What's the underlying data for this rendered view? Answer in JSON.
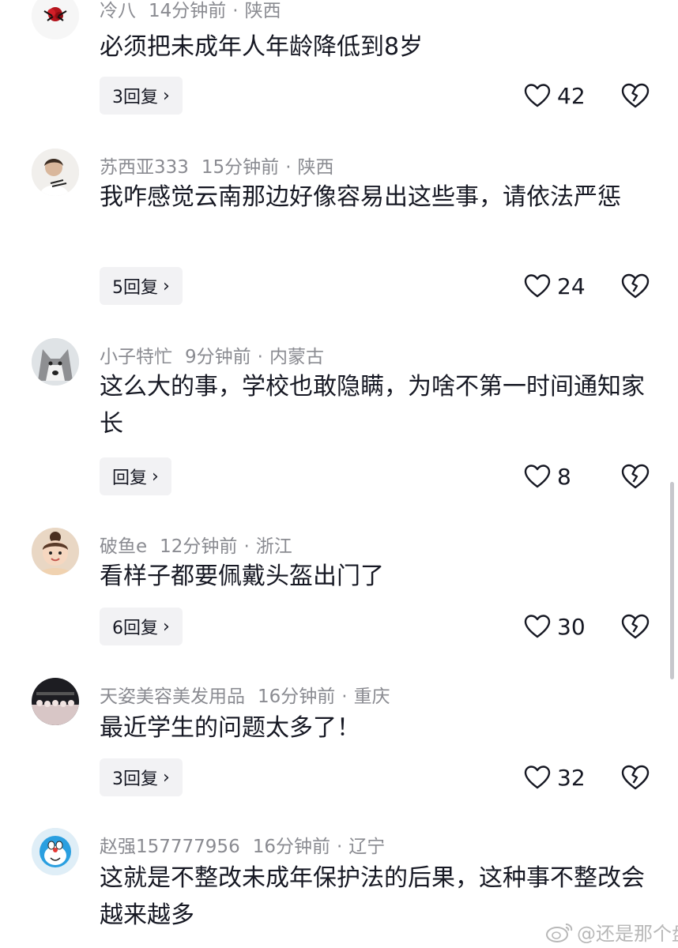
{
  "comments": [
    {
      "user": "冷八",
      "time": "14分钟前",
      "location": "陕西",
      "text": "必须把未成年人年龄降低到8岁",
      "replies": "3回复",
      "likes": "42"
    },
    {
      "user": "苏西亚333",
      "time": "15分钟前",
      "location": "陕西",
      "text": "我咋感觉云南那边好像容易出这些事，请依法严惩",
      "replies": "5回复",
      "likes": "24"
    },
    {
      "user": "小子特忙",
      "time": "9分钟前",
      "location": "内蒙古",
      "text": "这么大的事，学校也敢隐瞒，为啥不第一时间通知家长",
      "replies": "回复",
      "likes": "8"
    },
    {
      "user": "破鱼e",
      "time": "12分钟前",
      "location": "浙江",
      "text": "看样子都要佩戴头盔出门了",
      "replies": "6回复",
      "likes": "30"
    },
    {
      "user": "天姿美容美发用品",
      "time": "16分钟前",
      "location": "重庆",
      "text": "最近学生的问题太多了！",
      "replies": "3回复",
      "likes": "32"
    },
    {
      "user": "赵强157777956",
      "time": "16分钟前",
      "location": "辽宁",
      "text": "这就是不整改未成年保护法的后果，这种事不整改会越来越多",
      "replies": "",
      "likes": ""
    }
  ],
  "separator": "·",
  "chevron": "›",
  "watermark": "@还是那个盘",
  "icons": {
    "like": "heart-outline-icon",
    "dislike": "broken-heart-icon",
    "watermark": "weibo-icon"
  },
  "colors": {
    "text": "#161823",
    "meta": "#8a8b91",
    "reply_bg": "#f2f2f4"
  }
}
